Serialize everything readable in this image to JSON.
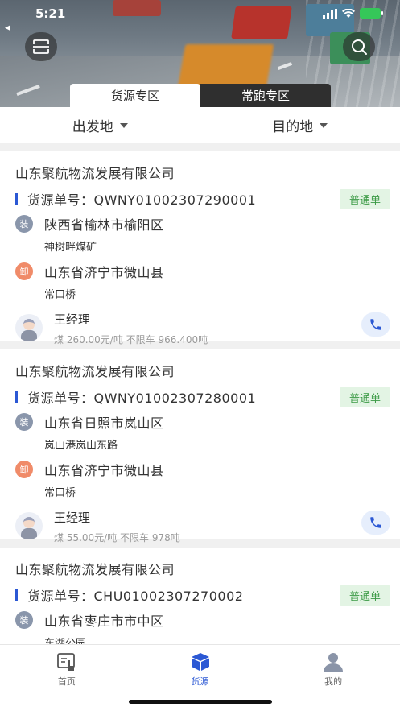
{
  "status_bar": {
    "time": "5:21",
    "back_label": "◀"
  },
  "header": {
    "zone_tabs": [
      {
        "label": "货源专区",
        "active": true
      },
      {
        "label": "常跑专区",
        "active": false
      }
    ],
    "scan_icon": "scan-icon",
    "search_icon": "search-icon"
  },
  "filters": {
    "origin_label": "出发地",
    "destination_label": "目的地"
  },
  "cards": [
    {
      "company": "山东聚航物流发展有限公司",
      "order": "货源单号：QWNY01002307290001",
      "badge": "普通单",
      "load_icon": "装",
      "load_region": "陕西省榆林市榆阳区",
      "load_detail": "神树畔煤矿",
      "unload_icon": "卸",
      "unload_region": "山东省济宁市微山县",
      "unload_detail": "常口桥",
      "contact_name": "王经理",
      "contact_info": "煤 260.00元/吨 不限车 966.400吨"
    },
    {
      "company": "山东聚航物流发展有限公司",
      "order": "货源单号：QWNY01002307280001",
      "badge": "普通单",
      "load_icon": "装",
      "load_region": "山东省日照市岚山区",
      "load_detail": "岚山港岚山东路",
      "unload_icon": "卸",
      "unload_region": "山东省济宁市微山县",
      "unload_detail": "常口桥",
      "contact_name": "王经理",
      "contact_info": "煤 55.00元/吨 不限车 978吨"
    },
    {
      "company": "山东聚航物流发展有限公司",
      "order": "货源单号：CHU01002307270002",
      "badge": "普通单",
      "load_icon": "装",
      "load_region": "山东省枣庄市市中区",
      "load_detail": "东湖公园"
    }
  ],
  "bottom_nav": [
    {
      "label": "首页",
      "icon": "home-icon",
      "active": false
    },
    {
      "label": "货源",
      "icon": "cargo-box-icon",
      "active": true
    },
    {
      "label": "我的",
      "icon": "user-icon",
      "active": false
    }
  ],
  "colors": {
    "accent": "#2b58d4",
    "badge_bg": "#e3f4e4",
    "badge_text": "#3b9a45",
    "load": "#8a96ab",
    "unload": "#f08b69"
  }
}
